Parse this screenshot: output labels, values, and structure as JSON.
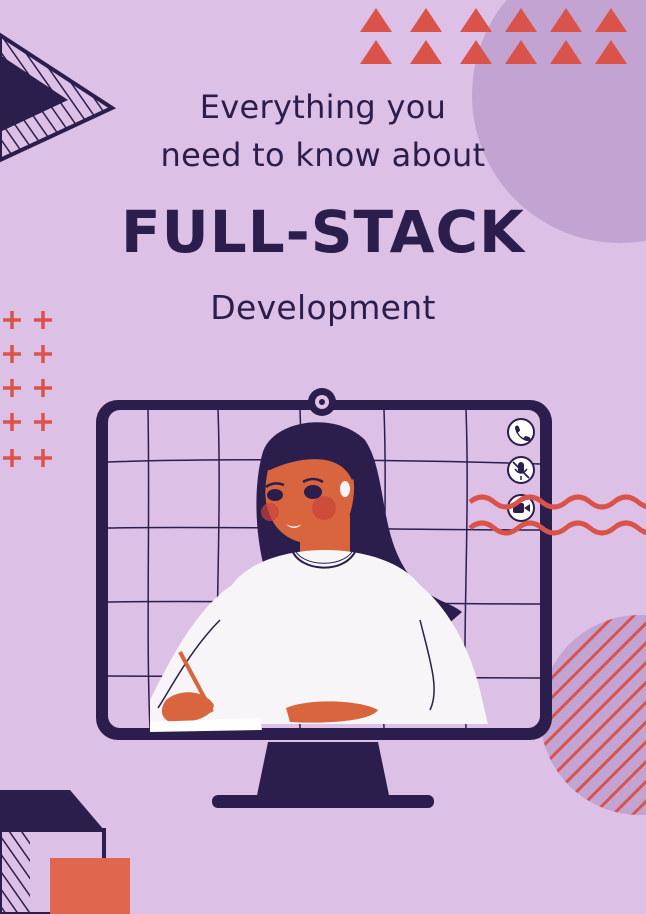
{
  "poster": {
    "line1": "Everything you",
    "line2": "need to know about",
    "headline": "FULL-STACK",
    "subheadline": "Development"
  },
  "colors": {
    "background": "#dcc0e6",
    "navy": "#2b1e4d",
    "coral": "#d9534a",
    "lilac_circle": "#c3a3d1",
    "skin": "#d9653e",
    "sweater": "#f7f5f7"
  },
  "icons": [
    "phone-icon",
    "mic-off-icon",
    "video-camera-icon"
  ]
}
